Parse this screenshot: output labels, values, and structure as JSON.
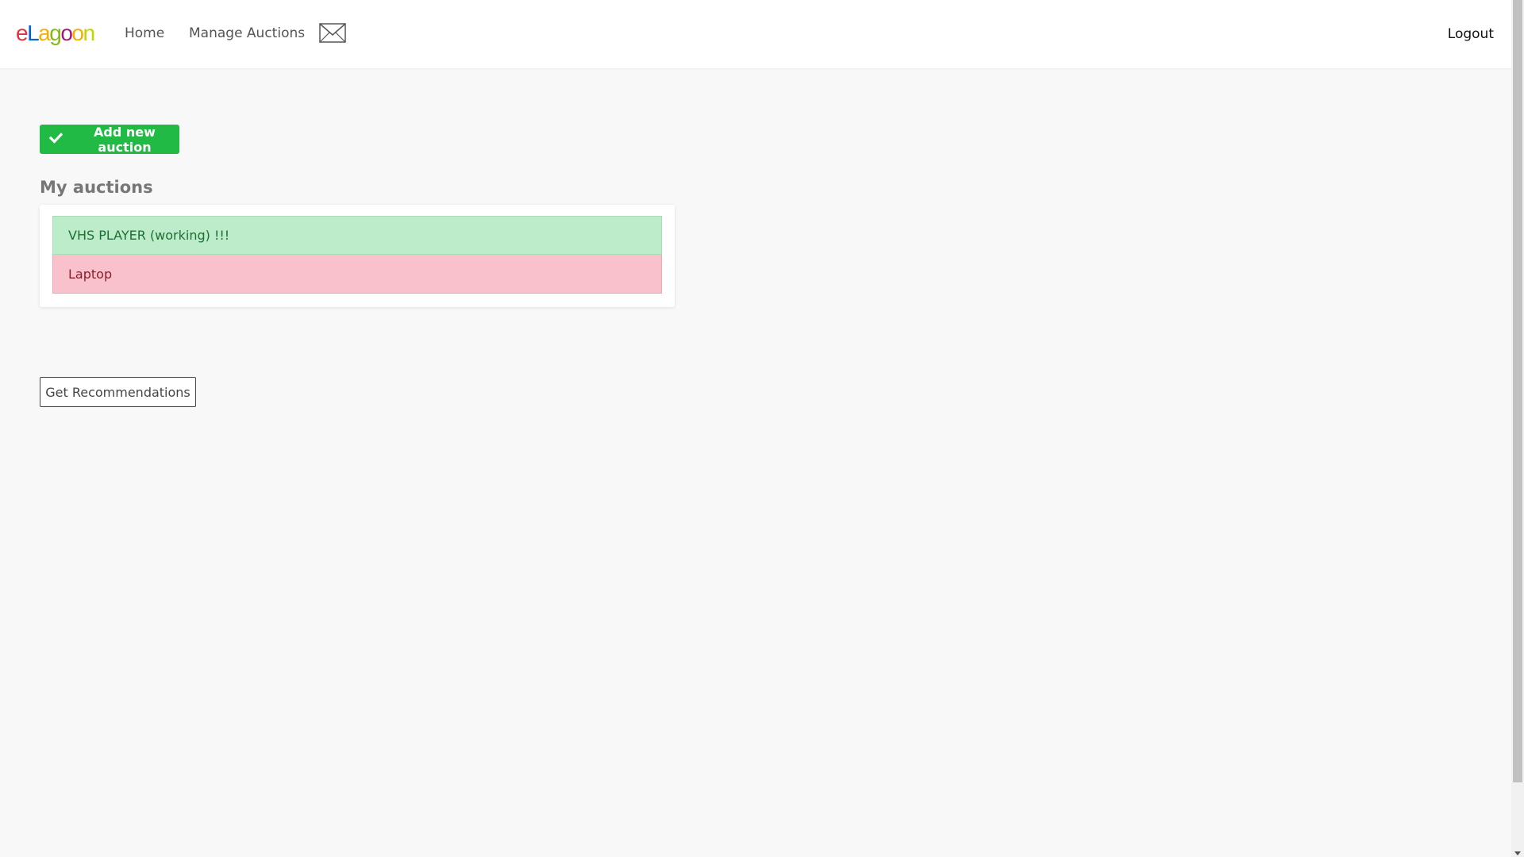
{
  "brand": {
    "letters": [
      "e",
      "L",
      "a",
      "g",
      "o",
      "o",
      "n"
    ]
  },
  "nav": {
    "home_label": "Home",
    "manage_label": "Manage Auctions",
    "mail_icon": "envelope-icon",
    "logout_label": "Logout"
  },
  "main": {
    "add_button_label": "Add new auction",
    "add_button_icon": "checkmark-icon",
    "section_title": "My auctions",
    "auctions": [
      {
        "title": "VHS PLAYER (working) !!!",
        "status_color": "#bdeccb"
      },
      {
        "title": "Laptop",
        "status_color": "#f8c1cb"
      }
    ],
    "recommendations_label": "Get Recommendations"
  },
  "colors": {
    "accent_green": "#21ba45",
    "background": "#f8f8f8"
  }
}
